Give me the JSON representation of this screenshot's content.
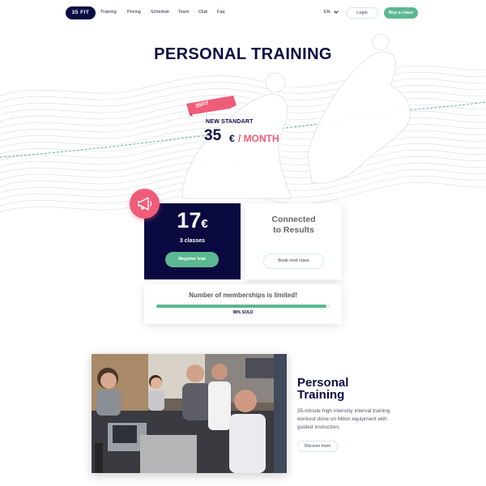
{
  "nav": {
    "logo": "35 FIT",
    "links": [
      "Training",
      "Pricing",
      "Schedule",
      "Team",
      "Club",
      "Faq"
    ],
    "language": "EN",
    "login_label": "Login",
    "buy_label": "Buy a class"
  },
  "hero": {
    "title": "PERSONAL TRAINING",
    "ribbon": "35FIT",
    "tagline": "NEW STANDART",
    "price": "35",
    "currency": "€",
    "per": "/ MONTH"
  },
  "offer": {
    "price": "17",
    "currency": "€",
    "classes": "3 classes",
    "register_label": "Register trial",
    "connected_line1": "Connected",
    "connected_line2": "to Results",
    "book_label": "Book next class"
  },
  "membership": {
    "title": "Number of memberships is limited!",
    "sold_percent": 98,
    "sold_text": "98% SOLD"
  },
  "section": {
    "title_line1": "Personal",
    "title_line2": "Training",
    "description": "35-minute high intensity interval training workout done on Milon equipment with guided instruction.",
    "discover_label": "Discover more"
  },
  "colors": {
    "navy": "#0c0c45",
    "green": "#5cb891",
    "pink": "#ef5d78"
  }
}
